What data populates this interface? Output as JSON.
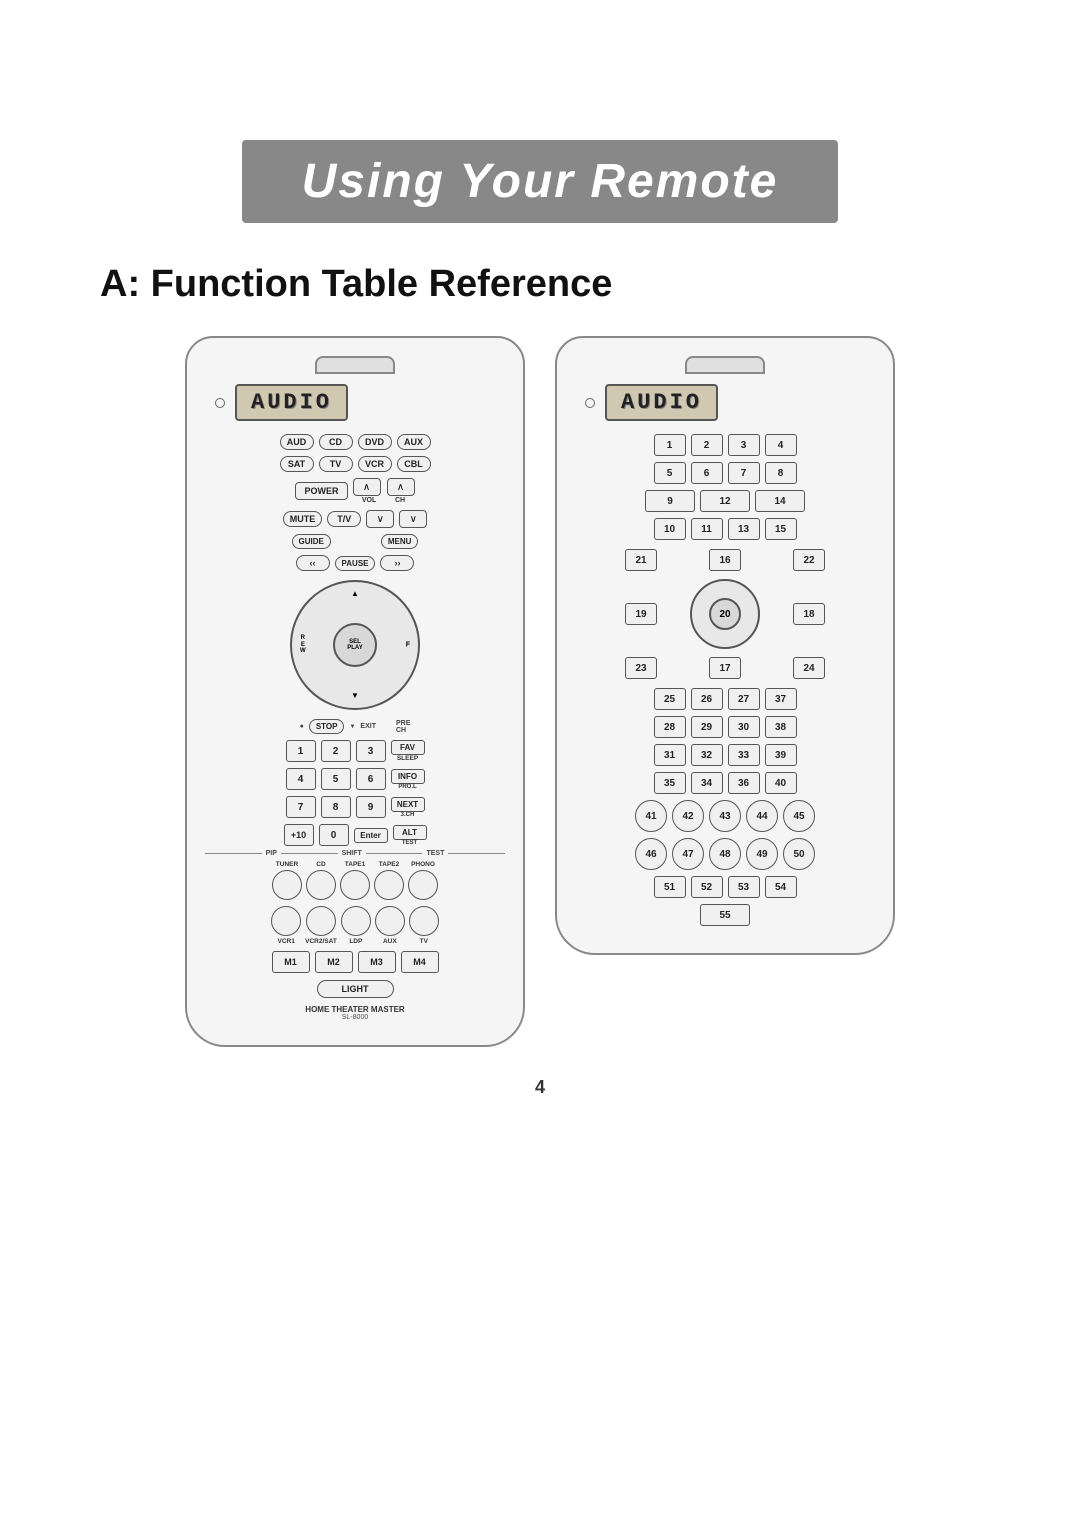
{
  "page": {
    "title": "Using Your Remote",
    "section": "A:  Function Table Reference",
    "page_number": "4"
  },
  "left_remote": {
    "display": "AUDIO",
    "mode_buttons": [
      "AUD",
      "CD",
      "DVD",
      "AUX",
      "SAT",
      "TV",
      "VCR",
      "CBL"
    ],
    "power": "POWER",
    "vol_label": "VOL",
    "ch_label": "CH",
    "mute": "MUTE",
    "tv": "T/V",
    "guide": "GUIDE",
    "menu": "MENU",
    "pause": "PAUSE",
    "sel_play": "SEL PLAY",
    "stop": "STOP",
    "exit": "EXIT",
    "pre_ch": "PRE CH",
    "num_buttons": [
      "1",
      "2",
      "3",
      "4",
      "5",
      "6",
      "7",
      "8",
      "9",
      "+10",
      "0",
      "ENTER"
    ],
    "fav_sleep": "FAV/SLEEP",
    "info_prol": "INFO/PRO.L",
    "next_3ch": "NEXT/3.CH",
    "alt_test": "ALT/TEST",
    "pip_shift": "PIP/SHIFT",
    "source_labels": [
      "TUNER",
      "CD",
      "TAPE1",
      "TAPE2",
      "PHONO"
    ],
    "vcr_labels": [
      "VCR1",
      "VCR2/SAT",
      "LDP",
      "AUX",
      "TV"
    ],
    "m_buttons": [
      "M1",
      "M2",
      "M3",
      "M4"
    ],
    "light": "LIGHT",
    "hmt": "HOME THEATER MASTER",
    "model": "SL-8000"
  },
  "right_remote": {
    "display": "AUDIO",
    "numbered_buttons": [
      {
        "num": "1"
      },
      {
        "num": "2"
      },
      {
        "num": "3"
      },
      {
        "num": "4"
      },
      {
        "num": "5"
      },
      {
        "num": "6"
      },
      {
        "num": "7"
      },
      {
        "num": "8"
      },
      {
        "num": "9",
        "wide": true
      },
      {
        "num": "12"
      },
      {
        "num": "14"
      },
      {
        "num": "10"
      },
      {
        "num": "11"
      },
      {
        "num": "13"
      },
      {
        "num": "15"
      },
      {
        "num": "21"
      },
      {
        "num": "16"
      },
      {
        "num": "22"
      },
      {
        "num": "19"
      },
      {
        "num": "20"
      },
      {
        "num": "18"
      },
      {
        "num": "23"
      },
      {
        "num": "17"
      },
      {
        "num": "24"
      },
      {
        "num": "25"
      },
      {
        "num": "26"
      },
      {
        "num": "27"
      },
      {
        "num": "37"
      },
      {
        "num": "28"
      },
      {
        "num": "29"
      },
      {
        "num": "30"
      },
      {
        "num": "38"
      },
      {
        "num": "31"
      },
      {
        "num": "32"
      },
      {
        "num": "33"
      },
      {
        "num": "39"
      },
      {
        "num": "35"
      },
      {
        "num": "34"
      },
      {
        "num": "36"
      },
      {
        "num": "40"
      },
      {
        "num": "41"
      },
      {
        "num": "42"
      },
      {
        "num": "43"
      },
      {
        "num": "44"
      },
      {
        "num": "45"
      },
      {
        "num": "46"
      },
      {
        "num": "47"
      },
      {
        "num": "48"
      },
      {
        "num": "49"
      },
      {
        "num": "50"
      },
      {
        "num": "51"
      },
      {
        "num": "52"
      },
      {
        "num": "53"
      },
      {
        "num": "54"
      },
      {
        "num": "55"
      }
    ]
  }
}
